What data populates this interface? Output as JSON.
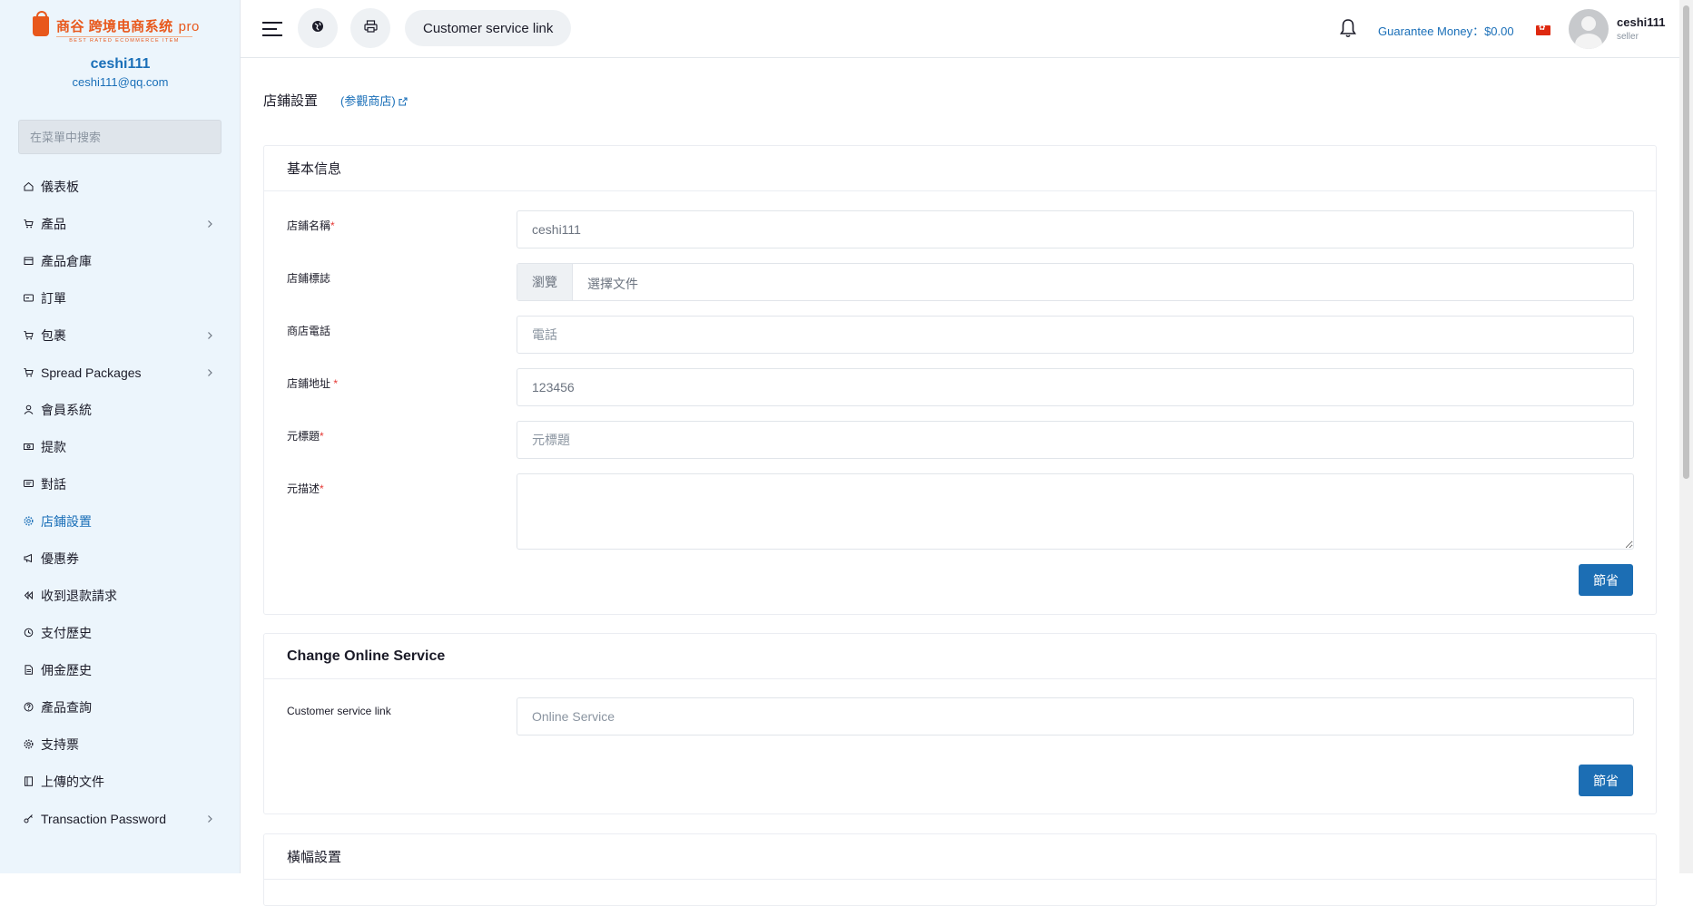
{
  "brand": {
    "name": "商谷 跨境电商系统",
    "suffix": "pro",
    "tagline": "BEST RATED ECOMMERCE ITEM"
  },
  "user": {
    "name": "ceshi111",
    "email": "ceshi111@qq.com",
    "role": "seller"
  },
  "sidebar": {
    "search_placeholder": "在菜單中搜索",
    "items": [
      {
        "label": "儀表板",
        "icon": "home-icon",
        "chevron": false,
        "active": false
      },
      {
        "label": "產品",
        "icon": "cart-icon",
        "chevron": true,
        "active": false
      },
      {
        "label": "產品倉庫",
        "icon": "warehouse-icon",
        "chevron": false,
        "active": false
      },
      {
        "label": "訂單",
        "icon": "card-icon",
        "chevron": false,
        "active": false
      },
      {
        "label": "包裹",
        "icon": "cart-icon",
        "chevron": true,
        "active": false
      },
      {
        "label": "Spread Packages",
        "icon": "cart-icon",
        "chevron": true,
        "active": false
      },
      {
        "label": "會員系統",
        "icon": "user-icon",
        "chevron": false,
        "active": false
      },
      {
        "label": "提款",
        "icon": "money-icon",
        "chevron": false,
        "active": false
      },
      {
        "label": "對話",
        "icon": "chat-icon",
        "chevron": false,
        "active": false
      },
      {
        "label": "店鋪設置",
        "icon": "gear-icon",
        "chevron": false,
        "active": true
      },
      {
        "label": "優惠券",
        "icon": "megaphone-icon",
        "chevron": false,
        "active": false
      },
      {
        "label": "收到退款請求",
        "icon": "backward-icon",
        "chevron": false,
        "active": false
      },
      {
        "label": "支付歷史",
        "icon": "history-icon",
        "chevron": false,
        "active": false
      },
      {
        "label": "佣金歷史",
        "icon": "file-icon",
        "chevron": false,
        "active": false
      },
      {
        "label": "產品查詢",
        "icon": "question-icon",
        "chevron": false,
        "active": false
      },
      {
        "label": "支持票",
        "icon": "support-icon",
        "chevron": false,
        "active": false
      },
      {
        "label": "上傳的文件",
        "icon": "folder-icon",
        "chevron": false,
        "active": false
      },
      {
        "label": "Transaction Password",
        "icon": "key-icon",
        "chevron": true,
        "active": false
      }
    ]
  },
  "topbar": {
    "customer_service_link": "Customer service link",
    "guarantee_money": "Guarantee Money：$0.00"
  },
  "page": {
    "title": "店鋪設置",
    "visit_shop": "(参觀商店)"
  },
  "basic_info": {
    "header": "基本信息",
    "shop_name_label": "店鋪名稱",
    "shop_name_value": "ceshi111",
    "shop_logo_label": "店鋪標誌",
    "browse_label": "瀏覽",
    "choose_file_label": "選擇文件",
    "phone_label": "商店電話",
    "phone_placeholder": "電話",
    "address_label": "店鋪地址",
    "address_value": "123456",
    "meta_title_label": "元標題",
    "meta_title_placeholder": "元標題",
    "meta_desc_label": "元描述",
    "save_label": "節省"
  },
  "online_service": {
    "header": "Change Online Service",
    "link_label": "Customer service link",
    "link_placeholder": "Online Service",
    "save_label": "節省"
  },
  "banner_settings": {
    "header": "橫幅設置"
  },
  "colors": {
    "accent": "#1a6fb8",
    "button": "#1c6eb4",
    "brand": "#e8581c",
    "sidebar_bg": "#ecf5fc"
  }
}
